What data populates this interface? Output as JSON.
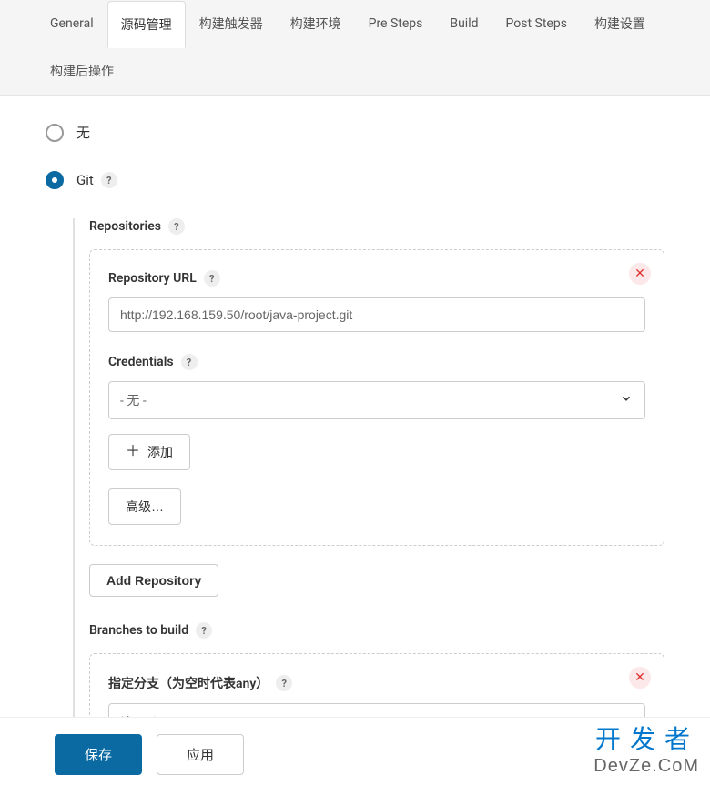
{
  "tabs": {
    "general": "General",
    "scm": "源码管理",
    "triggers": "构建触发器",
    "env": "构建环境",
    "presteps": "Pre Steps",
    "build": "Build",
    "poststeps": "Post Steps",
    "buildsettings": "构建设置",
    "postactions": "构建后操作"
  },
  "scm": {
    "none_label": "无",
    "git_label": "Git",
    "repositories_label": "Repositories",
    "repo_url_label": "Repository URL",
    "repo_url_value": "http://192.168.159.50/root/java-project.git",
    "credentials_label": "Credentials",
    "credentials_value": "- 无 -",
    "add_button": "添加",
    "advanced_button": "高级…",
    "add_repository_button": "Add Repository",
    "branches_label": "Branches to build",
    "branch_spec_label": "指定分支（为空时代表any）",
    "branch_spec_value": "*/master"
  },
  "footer": {
    "save": "保存",
    "apply": "应用"
  },
  "watermark": {
    "line1": "开发者",
    "line2": "DevZe.CoM"
  },
  "help": "?"
}
